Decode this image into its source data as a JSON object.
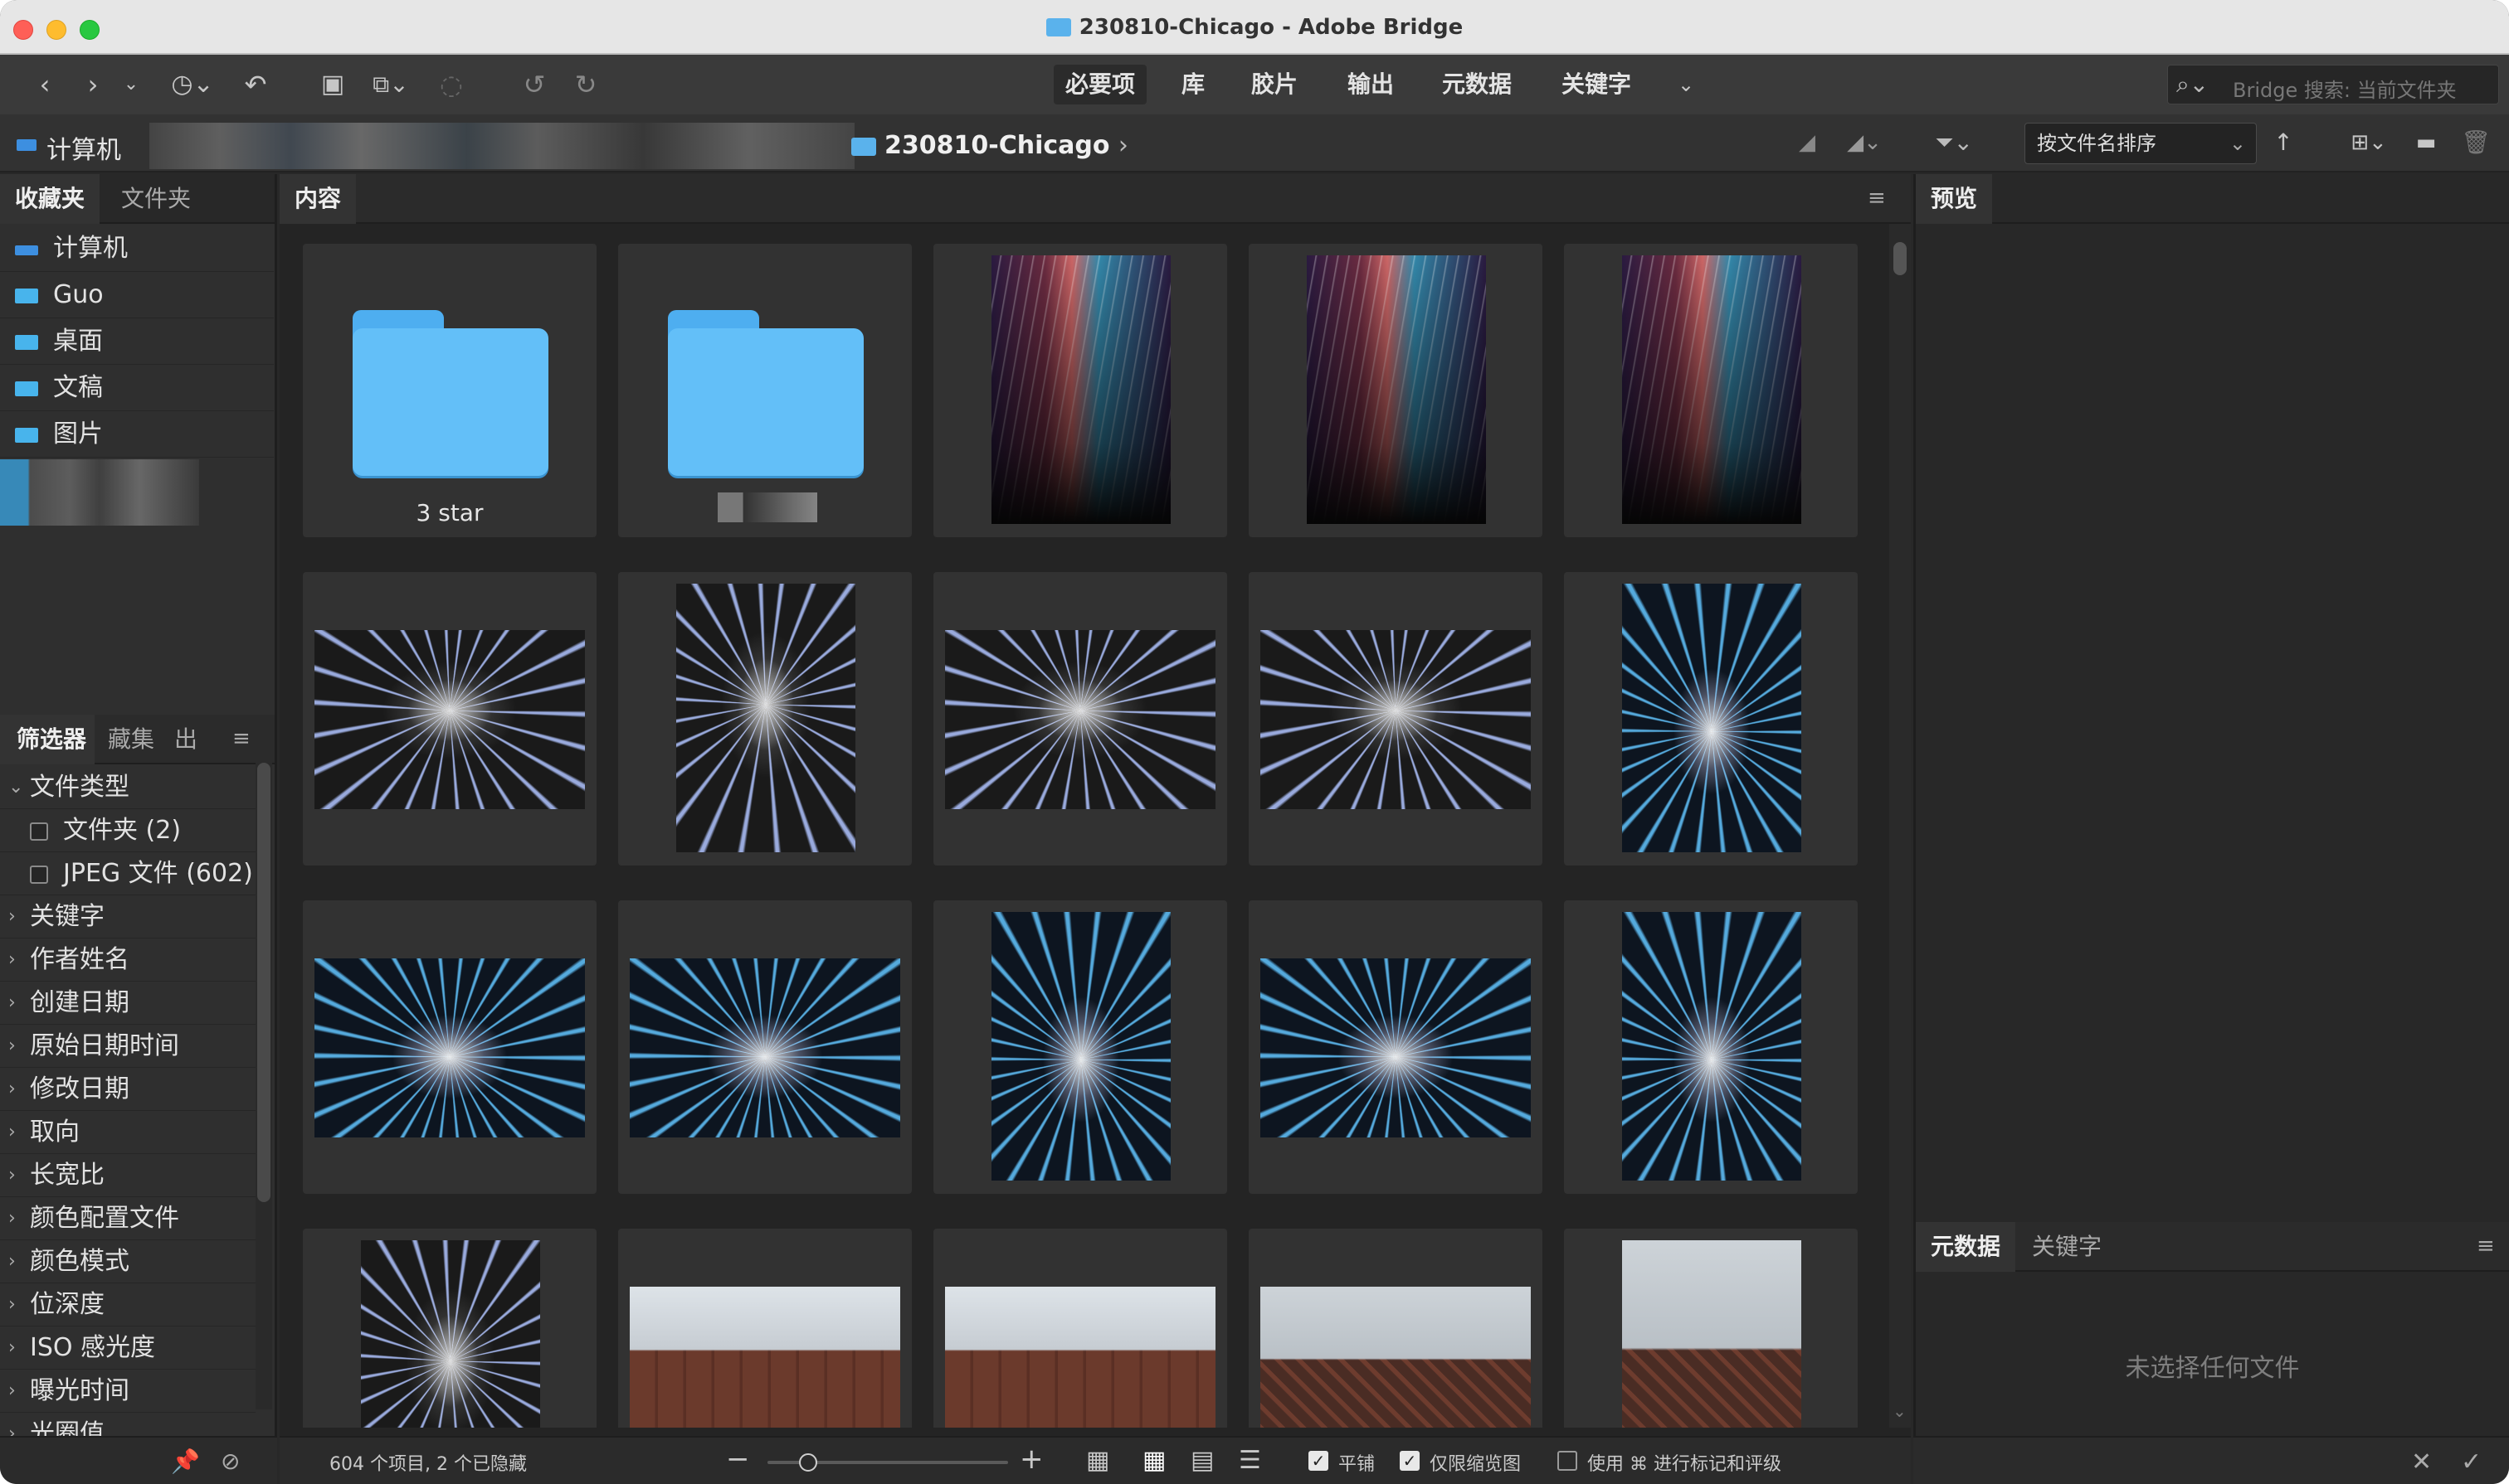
{
  "window": {
    "title": "230810-Chicago - Adobe Bridge"
  },
  "toolbar": {
    "workspaces": [
      "必要项",
      "库",
      "胶片",
      "输出",
      "元数据",
      "关键字"
    ],
    "active_workspace": "必要项",
    "search_placeholder": "Bridge 搜索: 当前文件夹"
  },
  "pathbar": {
    "root": "计算机",
    "current_folder": "230810-Chicago",
    "sort_label": "按文件名排序"
  },
  "left_panel": {
    "tabs": [
      "收藏夹",
      "文件夹"
    ],
    "favorites": [
      "计算机",
      "Guo",
      "桌面",
      "文稿",
      "图片"
    ],
    "filter_tabs": [
      "筛选器",
      "藏集",
      "出"
    ],
    "filters": {
      "file_type": "文件类型",
      "folder": "文件夹 (2)",
      "jpeg": "JPEG 文件 (602)",
      "categories": [
        "关键字",
        "作者姓名",
        "创建日期",
        "原始日期时间",
        "修改日期",
        "取向",
        "长宽比",
        "颜色配置文件",
        "颜色模式",
        "位深度",
        "ISO 感光度",
        "曝光时间",
        "光圈值"
      ]
    }
  },
  "content": {
    "tab": "内容",
    "folder_items": [
      {
        "name": "3 star"
      }
    ],
    "status": "604 个项目, 2 个已隐藏",
    "zoom_fraction": 0.17,
    "options": {
      "tile": "平铺",
      "thumbs_only": "仅限缩览图",
      "use_cmd": "使用 ⌘ 进行标记和评级"
    }
  },
  "right_panel": {
    "preview_tab": "预览",
    "meta_tabs": [
      "元数据",
      "关键字"
    ],
    "empty_text": "未选择任何文件"
  },
  "colors": {
    "accent": "#48b4ec",
    "background": "#282828"
  }
}
